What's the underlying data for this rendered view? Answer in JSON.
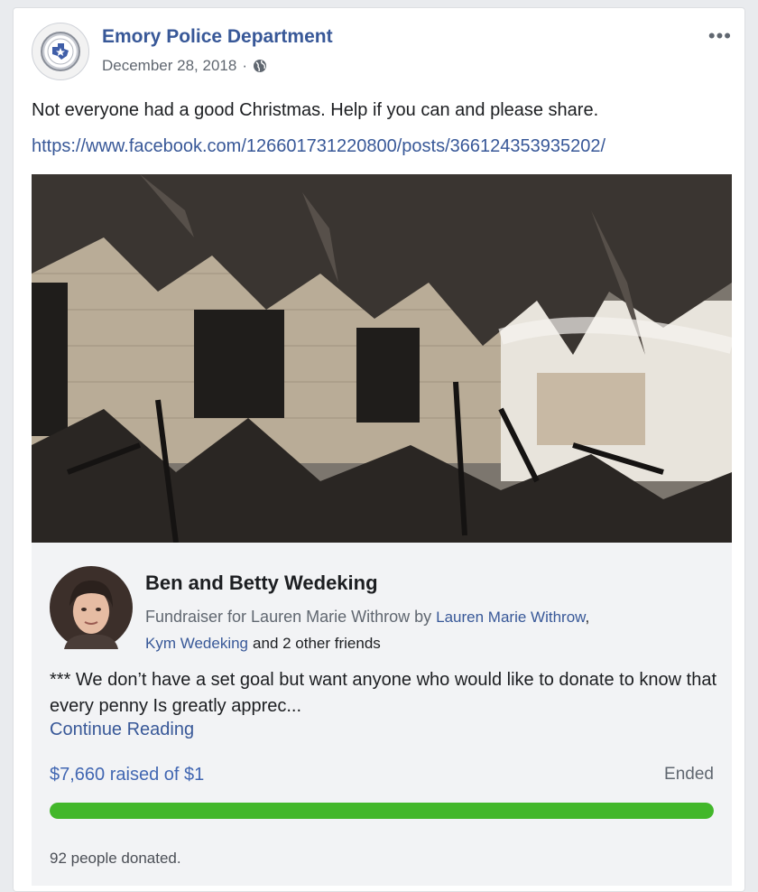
{
  "post": {
    "page_name": "Emory Police Department",
    "date": "December 28, 2018",
    "separator": "·",
    "privacy_icon": "globe-icon",
    "more_icon": "more-options-icon",
    "more_glyph": "•••",
    "text": "Not everyone had a good Christmas. Help if you can and please share.",
    "link": "https://www.facebook.com/126601731220800/posts/366124353935202/"
  },
  "fundraiser": {
    "title": "Ben and Betty Wedeking",
    "subtitle_prefix": "Fundraiser for Lauren Marie Withrow by",
    "friend_1": "Lauren Marie Withrow",
    "comma": ",",
    "friend_2": "Kym Wedeking",
    "others": "and 2 other friends",
    "description": "*** We don’t have a set goal but want anyone who would like to donate to know that every penny Is greatly apprec...",
    "continue_label": "Continue Reading",
    "raised_text": "$7,660 raised of $1",
    "status": "Ended",
    "progress_fraction": 1.0,
    "donors_text": "92 people donated."
  },
  "colors": {
    "link": "#385898",
    "progress": "#42b72a",
    "raised": "#4267b2"
  }
}
